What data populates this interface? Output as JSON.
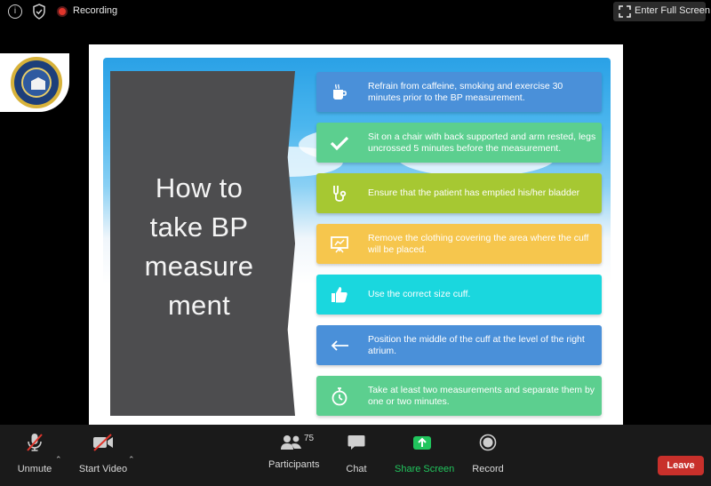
{
  "topbar": {
    "recording_label": "Recording",
    "fullscreen_label": "Enter Full Screen"
  },
  "slide": {
    "title": "How to take BP measure ment",
    "title_lines": [
      "How to",
      "take BP",
      "measure",
      "ment"
    ],
    "cards": [
      {
        "icon": "coffee-cup-icon",
        "color": "#4a90d9",
        "text": "Refrain from caffeine, smoking and exercise 30 minutes prior to the BP measurement."
      },
      {
        "icon": "checkmark-icon",
        "color": "#5ccf8f",
        "text": "Sit on a chair with back supported and arm rested, legs uncrossed 5 minutes before the measurement."
      },
      {
        "icon": "stethoscope-icon",
        "color": "#a6c832",
        "text": "Ensure that the patient has emptied his/her bladder"
      },
      {
        "icon": "presentation-board-icon",
        "color": "#f6c64d",
        "text": "Remove the clothing covering the area where the cuff will be placed."
      },
      {
        "icon": "thumbs-up-icon",
        "color": "#1ad7de",
        "text": "Use the correct size cuff."
      },
      {
        "icon": "arrow-left-icon",
        "color": "#4a90d9",
        "text": "Position the middle of the cuff at the level of the right atrium."
      },
      {
        "icon": "stopwatch-icon",
        "color": "#5ccf8f",
        "text": "Take at least two measurements and separate them by one or two minutes."
      }
    ]
  },
  "toolbar": {
    "unmute_label": "Unmute",
    "start_video_label": "Start Video",
    "participants_label": "Participants",
    "participants_count": "75",
    "chat_label": "Chat",
    "share_label": "Share Screen",
    "record_label": "Record",
    "leave_label": "Leave"
  },
  "colors": {
    "share_accent": "#21c55d",
    "leave_red": "#c8302b",
    "record_red": "#e0352b"
  }
}
